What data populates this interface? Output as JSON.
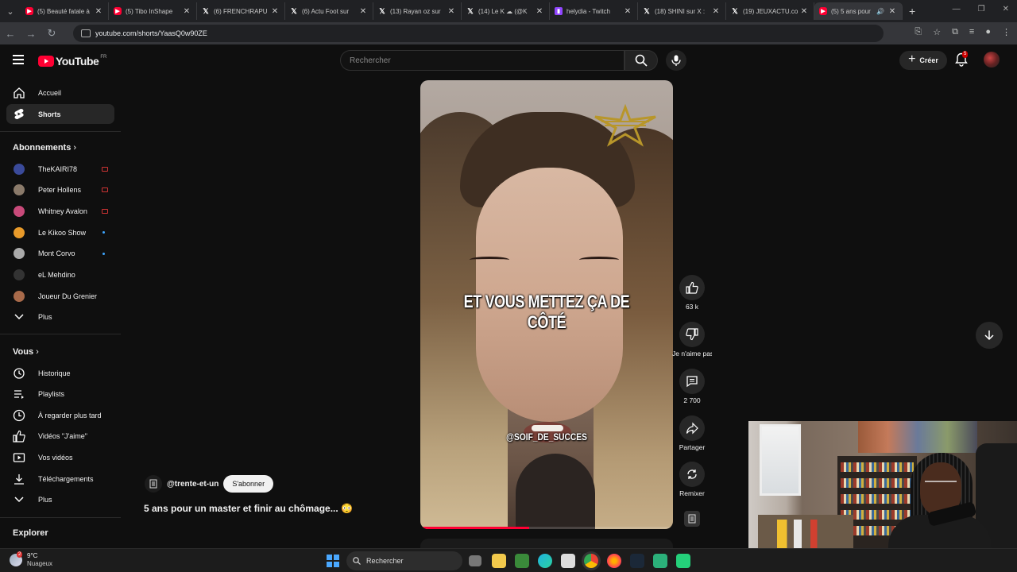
{
  "tabs": [
    {
      "label": "(5) Beauté fatale à",
      "icon": "yt"
    },
    {
      "label": "(5) Tibo InShape",
      "icon": "yt"
    },
    {
      "label": "(6) FRENCHRAPU",
      "icon": "x"
    },
    {
      "label": "(6) Actu Foot sur",
      "icon": "x"
    },
    {
      "label": "(13) Rayan oz sur",
      "icon": "x"
    },
    {
      "label": "(14) Le K ☁ (@K",
      "icon": "x"
    },
    {
      "label": "helydia - Twitch",
      "icon": "tw"
    },
    {
      "label": "(18) SHINI sur X :",
      "icon": "x"
    },
    {
      "label": "(19) JEUXACTU.co",
      "icon": "x"
    },
    {
      "label": "(5) 5 ans pour",
      "icon": "yt",
      "active": true
    }
  ],
  "address": {
    "url": "youtube.com/shorts/YaasQ0w90ZE"
  },
  "masthead": {
    "logo_text": "YouTube",
    "country": "FR",
    "search_placeholder": "Rechercher",
    "create_label": "Créer",
    "notif_count": "5"
  },
  "sidebar": {
    "main": [
      {
        "label": "Accueil",
        "icon": "home-icon"
      },
      {
        "label": "Shorts",
        "icon": "shorts-icon",
        "active": true
      }
    ],
    "subs_heading": "Abonnements",
    "subs": [
      {
        "label": "TheKAIRI78",
        "color": "#3a4a9a",
        "status": "live"
      },
      {
        "label": "Peter Hollens",
        "color": "#8a7a6a",
        "status": "live"
      },
      {
        "label": "Whitney Avalon",
        "color": "#c84a7a",
        "status": "live"
      },
      {
        "label": "Le Kikoo Show",
        "color": "#e89a2a",
        "status": "new"
      },
      {
        "label": "Mont Corvo",
        "color": "#aaaaaa",
        "status": "new"
      },
      {
        "label": "eL Mehdino",
        "color": "#333333",
        "status": ""
      },
      {
        "label": "Joueur Du Grenier",
        "color": "#a86a4a",
        "status": ""
      }
    ],
    "subs_more": "Plus",
    "you_heading": "Vous",
    "you": [
      {
        "label": "Historique",
        "icon": "history-icon"
      },
      {
        "label": "Playlists",
        "icon": "playlists-icon"
      },
      {
        "label": "À regarder plus tard",
        "icon": "watch-later-icon"
      },
      {
        "label": "Vidéos \"J'aime\"",
        "icon": "liked-icon"
      },
      {
        "label": "Vos vidéos",
        "icon": "your-videos-icon"
      },
      {
        "label": "Téléchargements",
        "icon": "downloads-icon"
      }
    ],
    "you_more": "Plus",
    "explore_heading": "Explorer"
  },
  "short": {
    "caption": "ET VOUS METTEZ ÇA DE CÔTÉ",
    "watermark": "@SOIF_DE_SUCCES",
    "progress": 0.43,
    "channel": "@trente-et-un",
    "subscribe_label": "S'abonner",
    "title": "5 ans pour un master et finir au chômage... 😳"
  },
  "actions": {
    "like_count": "63 k",
    "dislike_label": "Je n'aime pas",
    "comment_count": "2 700",
    "share_label": "Partager",
    "remix_label": "Remixer"
  },
  "taskbar": {
    "temp": "9°C",
    "weather": "Nuageux",
    "weather_badge": "2",
    "search_label": "Rechercher"
  },
  "colors": {
    "yt_red": "#ff0033",
    "bg": "#0f0f0f",
    "twitch": "#9146ff"
  }
}
